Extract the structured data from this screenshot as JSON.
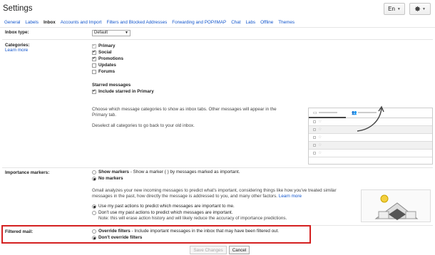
{
  "header": {
    "title": "Settings",
    "lang": "En"
  },
  "tabs": [
    {
      "label": "General"
    },
    {
      "label": "Labels"
    },
    {
      "label": "Inbox"
    },
    {
      "label": "Accounts and Import"
    },
    {
      "label": "Filters and Blocked Addresses"
    },
    {
      "label": "Forwarding and POP/IMAP"
    },
    {
      "label": "Chat"
    },
    {
      "label": "Labs"
    },
    {
      "label": "Offline"
    },
    {
      "label": "Themes"
    }
  ],
  "inbox_type": {
    "label": "Inbox type:",
    "value": "Default"
  },
  "categories": {
    "label": "Categories:",
    "learn_more": "Learn more",
    "items": [
      {
        "label": "Primary",
        "checked": true
      },
      {
        "label": "Social",
        "checked": true
      },
      {
        "label": "Promotions",
        "checked": true
      },
      {
        "label": "Updates",
        "checked": false
      },
      {
        "label": "Forums",
        "checked": false
      }
    ],
    "starred_heading": "Starred messages",
    "starred_label": "Include starred in Primary",
    "help_1": "Choose which message categories to show as inbox tabs. Other messages will appear in the",
    "help_2": "Primary tab.",
    "help_3": "Deselect all categories to go back to your old inbox."
  },
  "importance": {
    "label": "Importance markers:",
    "show_bold": "Show markers",
    "show_rest": " - Show a marker ( ) by messages marked as important.",
    "no_markers": "No markers",
    "desc_1": "Gmail analyzes your new incoming messages to predict what's important, considering things like how you've treated similar",
    "desc_2": "messages in the past, how directly the message is addressed to you, and many other factors.",
    "desc_learn": "Learn more",
    "use_past": "Use my past actions to predict which messages are important to me.",
    "dont_use": "Don't use my past actions to predict which messages are important.",
    "note": "Note: this will erase action history and will likely reduce the accuracy of importance predictions."
  },
  "filtered": {
    "label": "Filtered mail:",
    "override_bold": "Override filters",
    "override_rest": " - Include important messages in the inbox that may have been filtered out.",
    "dont_override": "Don't override filters"
  },
  "buttons": {
    "save": "Save Changes",
    "cancel": "Cancel"
  },
  "colors": {
    "link": "#1155cc",
    "highlight": "#d42020"
  }
}
